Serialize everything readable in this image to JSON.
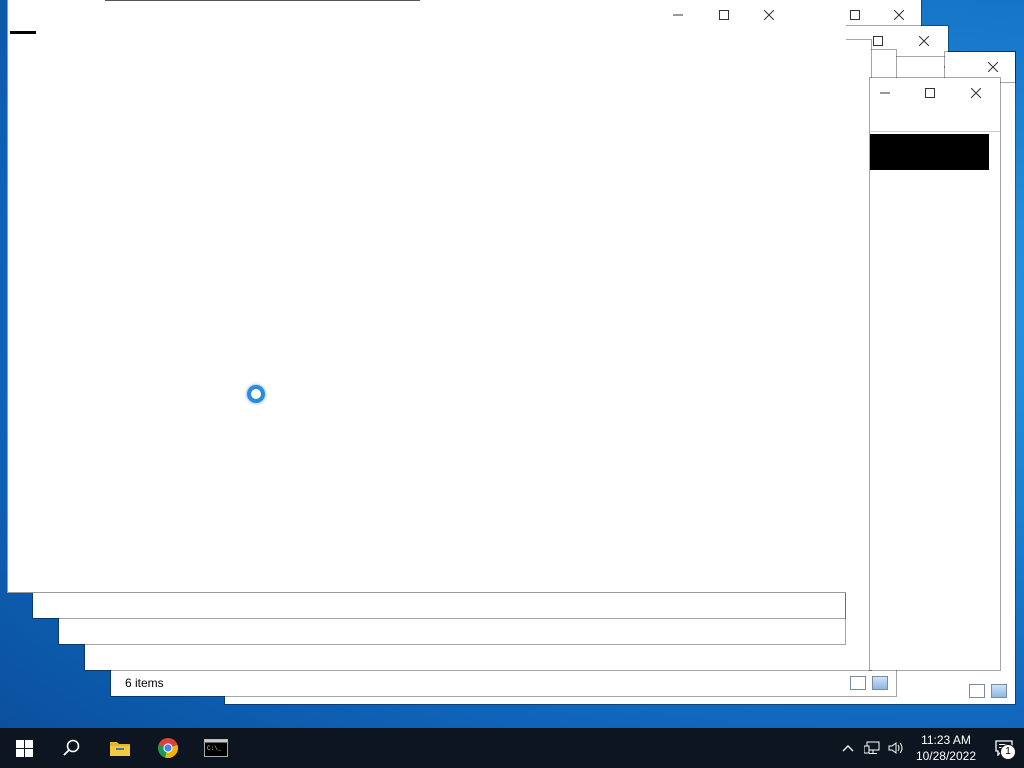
{
  "desktop": {
    "background_color": "#1a7fd0"
  },
  "windows": {
    "back_right": {
      "statusbar_icons": [
        "details-view-icon",
        "large-icons-view-icon"
      ]
    },
    "explorer": {
      "status_count": "6 items"
    },
    "small_right": {}
  },
  "taskbar": {
    "pinned": [
      {
        "name": "start",
        "icon": "windows-logo-icon"
      },
      {
        "name": "search",
        "icon": "search-icon"
      },
      {
        "name": "file-explorer",
        "icon": "folder-icon"
      },
      {
        "name": "chrome",
        "icon": "chrome-icon"
      },
      {
        "name": "command-prompt",
        "icon": "cmd-icon"
      }
    ],
    "tray": {
      "time": "11:23 AM",
      "date": "10/28/2022",
      "notification_count": "1"
    }
  }
}
